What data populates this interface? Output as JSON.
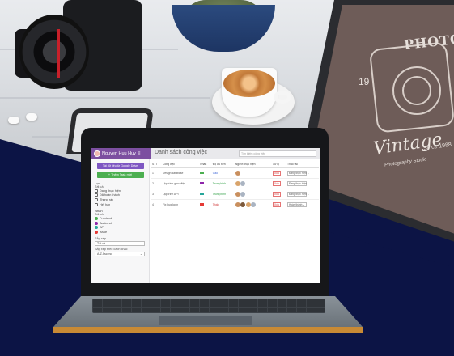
{
  "background_photo": {
    "back_laptop_title": "PHOTOGRA",
    "back_laptop_year": "19",
    "back_laptop_script": "Vintage",
    "back_laptop_since": "Since 1988",
    "back_laptop_subtitle": "Photography Studio"
  },
  "app": {
    "user_name": "Nguyen Huu Huy",
    "page_title": "Danh sách công việc",
    "search_placeholder": "Tìm kiếm công việc"
  },
  "sidebar": {
    "primary_button": "Tải dữ liệu từ Google Drive",
    "green_button": "+ Thêm Task mới",
    "loc_heading": "Lọc",
    "loc_sub": "Tất cả",
    "filters": [
      {
        "icon": "folder-icon",
        "label": "Đang thực hiện"
      },
      {
        "icon": "check-icon",
        "label": "Đã hoàn thành"
      },
      {
        "icon": "trash-icon",
        "label": "Thùng rác"
      },
      {
        "icon": "clock-icon",
        "label": "Hết hạn"
      }
    ],
    "nhan_heading": "Nhãn",
    "nhan_sub": "Tất cả",
    "labels": [
      {
        "color": "#4caf50",
        "label": "Frontend"
      },
      {
        "color": "#8e24aa",
        "label": "Backend"
      },
      {
        "color": "#26a69a",
        "label": "API"
      },
      {
        "color": "#e53935",
        "label": "Issue"
      }
    ],
    "sort_label": "Sắp xếp",
    "sort_value": "Tất cả",
    "sort2_label": "Sắp xếp theo cách khác",
    "sort2_value": "A-Z Ascend"
  },
  "table": {
    "headers": [
      "STT",
      "Công việc",
      "Nhãn",
      "Độ ưu tiên",
      "Người thực hiện",
      "",
      "Xử lý",
      "Thao tác"
    ],
    "rows": [
      {
        "stt": "1",
        "task": "Design database",
        "label_color": "#4caf50",
        "priority": "Cao",
        "priority_class": "tag-blue",
        "avatars": [
          "#c98f5e"
        ],
        "status": "Xóa",
        "action": "Đang thực hiện"
      },
      {
        "stt": "2",
        "task": "Lập trình giao diện",
        "label_color": "#8e24aa",
        "priority": "Trung bình",
        "priority_class": "tag",
        "avatars": [
          "#d9a46b",
          "#aab4c2"
        ],
        "status": "Xóa",
        "action": "Đang thực hiện"
      },
      {
        "stt": "3",
        "task": "Lập trình API",
        "label_color": "#26a69a",
        "priority": "Trung bình",
        "priority_class": "tag",
        "avatars": [
          "#c98f5e",
          "#aab4c2"
        ],
        "status": "Xóa",
        "action": "Đang thực hiện"
      },
      {
        "stt": "4",
        "task": "Fix bug login",
        "label_color": "#e53935",
        "priority": "Thấp",
        "priority_class": "tag-red",
        "avatars": [
          "#c98f5e",
          "#7d5a3c",
          "#d9a46b",
          "#aab4c2"
        ],
        "status": "Xóa",
        "action": "Hoàn thành"
      }
    ]
  }
}
